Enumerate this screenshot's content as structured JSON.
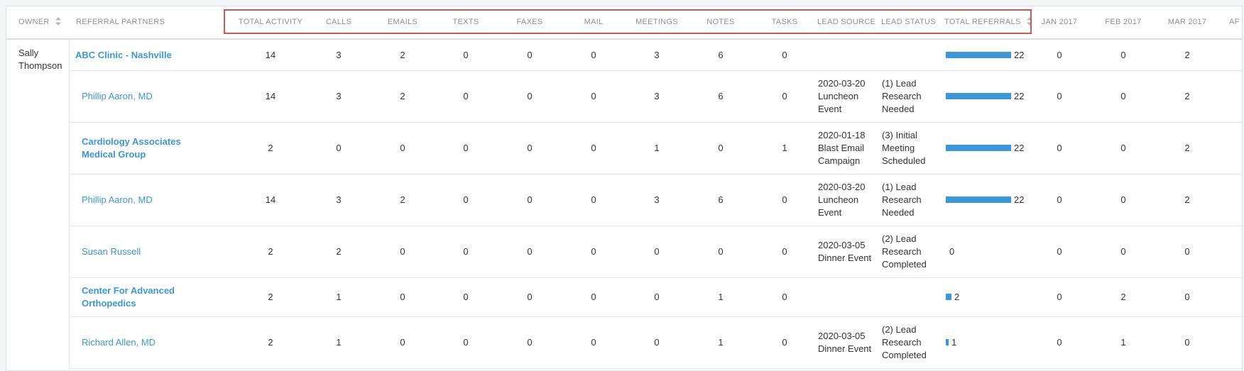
{
  "colors": {
    "accent": "#3a97d9",
    "highlight_border": "#d9534f",
    "header_text": "#8a9099"
  },
  "header": {
    "owner": "OWNER",
    "referral_partners": "REFERRAL PARTNERS",
    "total_activity": "TOTAL ACTIVITY",
    "calls": "CALLS",
    "emails": "EMAILS",
    "texts": "TEXTS",
    "faxes": "FAXES",
    "mail": "MAIL",
    "meetings": "MEETINGS",
    "notes": "NOTES",
    "tasks": "TASKS",
    "lead_source": "LEAD SOURCE",
    "lead_status": "LEAD STATUS",
    "total_referrals": "TOTAL REFERRALS",
    "jan": "JAN 2017",
    "feb": "FEB 2017",
    "mar": "MAR 2017",
    "apr": "AF"
  },
  "owner_group": {
    "name": "Sally Thompson"
  },
  "rows": [
    {
      "partner": "ABC Clinic - Nashville",
      "is_group": true,
      "total_activity": "14",
      "calls": "3",
      "emails": "2",
      "texts": "0",
      "faxes": "0",
      "mail": "0",
      "meetings": "3",
      "notes": "6",
      "tasks": "0",
      "lead_source": "",
      "lead_status": "",
      "total_referrals": 22,
      "total_referrals_label": "22",
      "jan": "0",
      "feb": "0",
      "mar": "2"
    },
    {
      "partner": "Phillip Aaron, MD",
      "is_group": false,
      "total_activity": "14",
      "calls": "3",
      "emails": "2",
      "texts": "0",
      "faxes": "0",
      "mail": "0",
      "meetings": "3",
      "notes": "6",
      "tasks": "0",
      "lead_source": "2020-03-20 Luncheon Event",
      "lead_status": "(1) Lead Research Needed",
      "total_referrals": 22,
      "total_referrals_label": "22",
      "jan": "0",
      "feb": "0",
      "mar": "2"
    },
    {
      "partner": "Cardiology Associates Medical Group",
      "is_group": true,
      "total_activity": "2",
      "calls": "0",
      "emails": "0",
      "texts": "0",
      "faxes": "0",
      "mail": "0",
      "meetings": "1",
      "notes": "0",
      "tasks": "1",
      "lead_source": "2020-01-18 Blast Email Campaign",
      "lead_status": "(3) Initial Meeting Scheduled",
      "total_referrals": 22,
      "total_referrals_label": "22",
      "jan": "0",
      "feb": "0",
      "mar": "2"
    },
    {
      "partner": "Phillip Aaron, MD",
      "is_group": false,
      "total_activity": "14",
      "calls": "3",
      "emails": "2",
      "texts": "0",
      "faxes": "0",
      "mail": "0",
      "meetings": "3",
      "notes": "6",
      "tasks": "0",
      "lead_source": "2020-03-20 Luncheon Event",
      "lead_status": "(1) Lead Research Needed",
      "total_referrals": 22,
      "total_referrals_label": "22",
      "jan": "0",
      "feb": "0",
      "mar": "2"
    },
    {
      "partner": "Susan Russell",
      "is_group": false,
      "total_activity": "2",
      "calls": "2",
      "emails": "0",
      "texts": "0",
      "faxes": "0",
      "mail": "0",
      "meetings": "0",
      "notes": "0",
      "tasks": "0",
      "lead_source": "2020-03-05 Dinner Event",
      "lead_status": "(2) Lead Research Completed",
      "total_referrals": 0,
      "total_referrals_label": "0",
      "jan": "0",
      "feb": "0",
      "mar": "0"
    },
    {
      "partner": "Center For Advanced Orthopedics",
      "is_group": true,
      "total_activity": "2",
      "calls": "1",
      "emails": "0",
      "texts": "0",
      "faxes": "0",
      "mail": "0",
      "meetings": "0",
      "notes": "1",
      "tasks": "0",
      "lead_source": "",
      "lead_status": "",
      "total_referrals": 2,
      "total_referrals_label": "2",
      "jan": "0",
      "feb": "2",
      "mar": "0"
    },
    {
      "partner": "Richard Allen, MD",
      "is_group": false,
      "total_activity": "2",
      "calls": "1",
      "emails": "0",
      "texts": "0",
      "faxes": "0",
      "mail": "0",
      "meetings": "0",
      "notes": "1",
      "tasks": "0",
      "lead_source": "2020-03-05 Dinner Event",
      "lead_status": "(2) Lead Research Completed",
      "total_referrals": 1,
      "total_referrals_label": "1",
      "jan": "0",
      "feb": "1",
      "mar": "0"
    }
  ]
}
